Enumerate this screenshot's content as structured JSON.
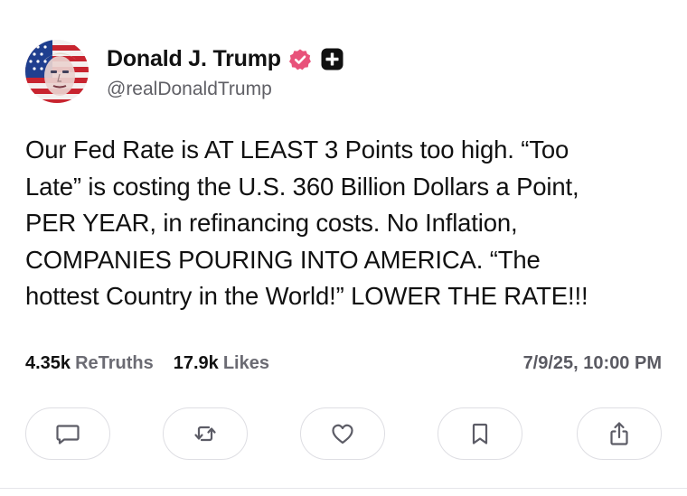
{
  "author": {
    "display_name": "Donald J. Trump",
    "handle": "@realDonaldTrump"
  },
  "post": {
    "body": "Our Fed Rate is AT LEAST 3 Points too high. “Too\nLate” is costing the U.S. 360 Billion Dollars a Point,\nPER YEAR, in refinancing costs. No Inflation,\nCOMPANIES POURING INTO AMERICA. “The\nhottest Country in the World!” LOWER THE RATE!!!",
    "retruths_count": "4.35k",
    "retruths_label": "ReTruths",
    "likes_count": "17.9k",
    "likes_label": "Likes",
    "timestamp": "7/9/25, 10:00 PM"
  },
  "actions": {
    "icons": [
      "comment-icon",
      "retruth-icon",
      "heart-icon",
      "bookmark-icon",
      "share-icon"
    ]
  },
  "colors": {
    "verified_badge": "#e8527a",
    "plus_badge": "#111111",
    "secondary_text": "#606066",
    "button_border": "#dedee3",
    "icon_stroke": "#5c5c66"
  }
}
